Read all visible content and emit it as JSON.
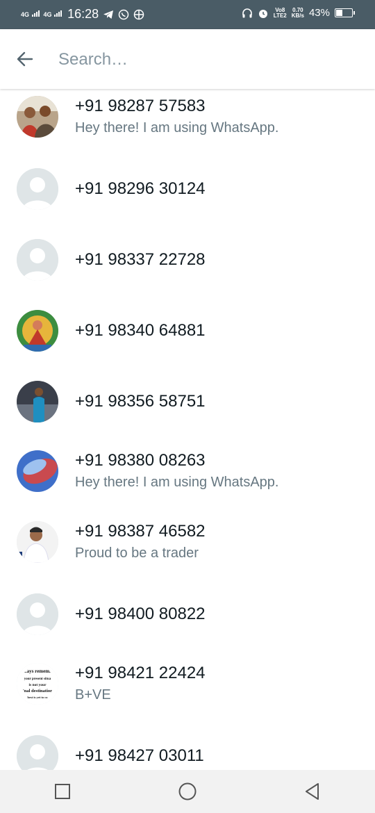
{
  "status_bar": {
    "net1": "4G",
    "net2": "4G",
    "time": "16:28",
    "volte_top": "Vo8",
    "volte_bottom": "LTE2",
    "speed_top": "0.70",
    "speed_bottom": "KB/s",
    "battery": "43%",
    "battery_level": 0.43,
    "icons": [
      "telegram-icon",
      "whatsapp-icon",
      "settings-icon",
      "headphones-icon",
      "alarm-icon"
    ]
  },
  "search": {
    "placeholder": "Search…",
    "value": ""
  },
  "contacts": [
    {
      "name": "+91 98287 57583",
      "status": "Hey there! I am using WhatsApp.",
      "avatar": "photo-couple"
    },
    {
      "name": "+91 98296 30124",
      "status": "",
      "avatar": "default"
    },
    {
      "name": "+91 98337 22728",
      "status": "",
      "avatar": "default"
    },
    {
      "name": "+91 98340 64881",
      "status": "",
      "avatar": "photo-deity"
    },
    {
      "name": "+91 98356 58751",
      "status": "",
      "avatar": "photo-person-blue"
    },
    {
      "name": "+91 98380 08263",
      "status": "Hey there! I am using WhatsApp.",
      "avatar": "photo-abstract-blue"
    },
    {
      "name": "+91 98387 46582",
      "status": "Proud to be a trader",
      "avatar": "photo-man-white"
    },
    {
      "name": "+91 98400 80822",
      "status": "",
      "avatar": "default"
    },
    {
      "name": "+91 98421 22424",
      "status": "B+VE",
      "avatar": "quote-text",
      "avatar_text": [
        "..ays remem.",
        "your present situa",
        "is not your",
        "'nal destinatior",
        "best is yet to co"
      ]
    },
    {
      "name": "+91 98427 03011",
      "status": "",
      "avatar": "default"
    }
  ],
  "nav": {
    "buttons": [
      "recents-button",
      "home-button",
      "back-button"
    ]
  },
  "colors": {
    "status_bar_bg": "#4a5c66",
    "primary_text": "#111b21",
    "secondary_text": "#667781",
    "placeholder": "#8696a0",
    "default_avatar_bg": "#dfe5e7"
  }
}
